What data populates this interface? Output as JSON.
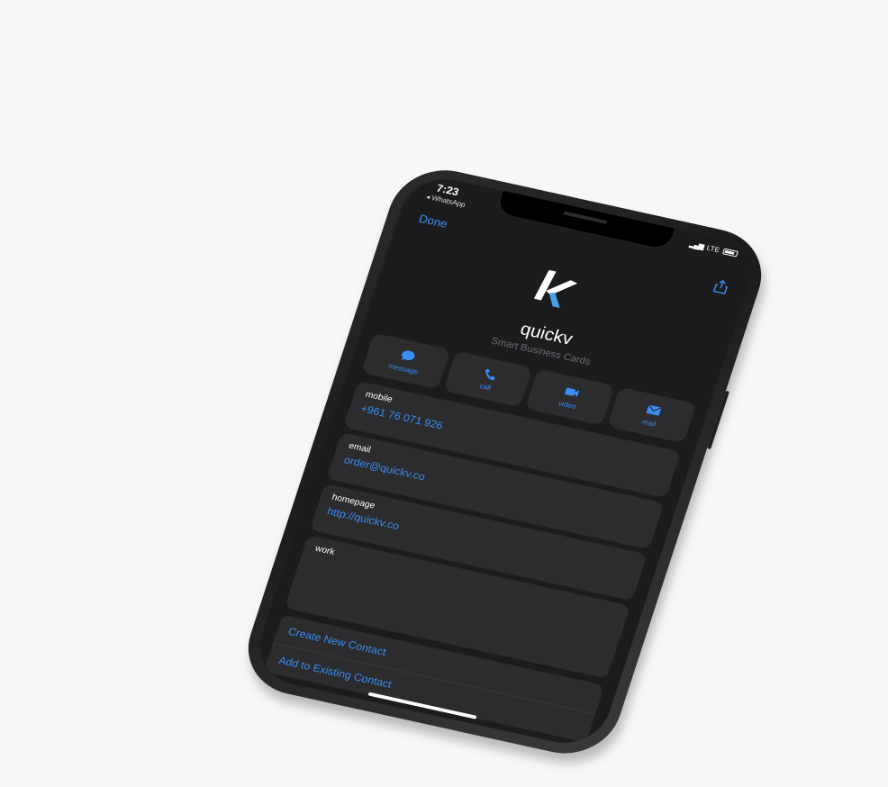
{
  "status": {
    "time": "7:23",
    "back_app": "◂ WhatsApp",
    "network": "LTE"
  },
  "header": {
    "done_label": "Done"
  },
  "contact": {
    "name": "quickv",
    "subtitle": "Smart Business Cards"
  },
  "actions": [
    {
      "label": "message"
    },
    {
      "label": "call"
    },
    {
      "label": "video"
    },
    {
      "label": "mail"
    }
  ],
  "fields": [
    {
      "label": "mobile",
      "value": "+961 76 071 926"
    },
    {
      "label": "email",
      "value": "order@quickv.co"
    },
    {
      "label": "homepage",
      "value": "http://quickv.co"
    },
    {
      "label": "work",
      "value": ""
    }
  ],
  "buttons": {
    "create_new": "Create New Contact",
    "add_existing": "Add to Existing Contact"
  },
  "colors": {
    "accent": "#3a8ef6",
    "background": "#1c1c1e",
    "card": "#2c2c2e"
  }
}
